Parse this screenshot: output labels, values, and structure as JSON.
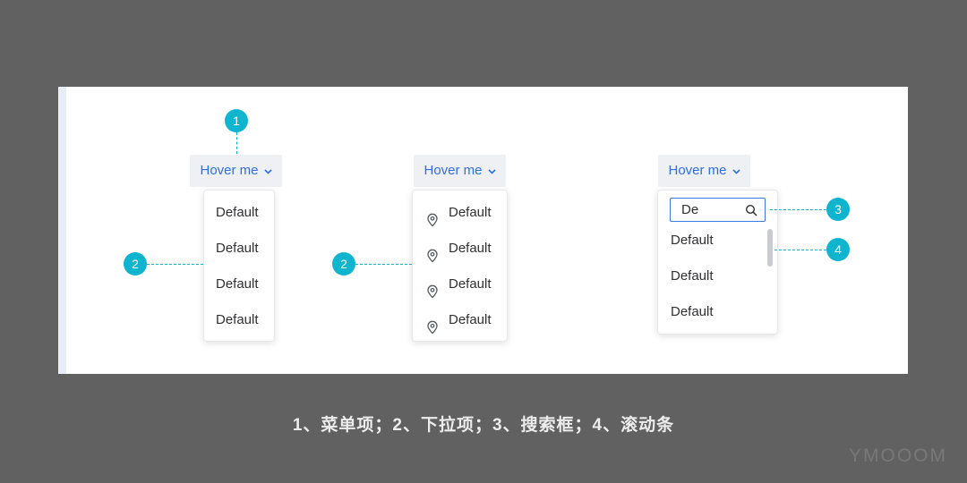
{
  "dropdowns": [
    {
      "trigger_label": "Hover me",
      "items": [
        "Default",
        "Default",
        "Default",
        "Default"
      ]
    },
    {
      "trigger_label": "Hover me",
      "items": [
        "Default",
        "Default",
        "Default",
        "Default"
      ]
    },
    {
      "trigger_label": "Hover me",
      "search_value": "De",
      "items": [
        "Default",
        "Default",
        "Default"
      ]
    }
  ],
  "markers": {
    "m1": "1",
    "m2a": "2",
    "m2b": "2",
    "m3": "3",
    "m4": "4"
  },
  "caption": "1、菜单项；2、下拉项；3、搜索框；4、滚动条",
  "watermark": "YMOOOM",
  "icons": {
    "chevron": "chevron-down-icon",
    "location": "location-pin-icon",
    "search": "search-icon"
  },
  "colors": {
    "accent": "#2f6fe6",
    "marker": "#0fb5cf",
    "background": "#616161"
  }
}
